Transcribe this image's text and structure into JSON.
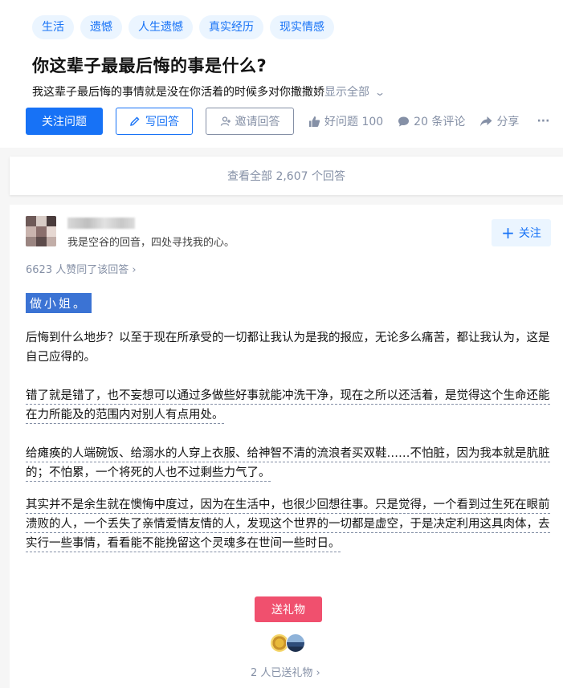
{
  "question": {
    "tags": [
      "生活",
      "遗憾",
      "人生遗憾",
      "真实经历",
      "现实情感"
    ],
    "title": "你这辈子最最后悔的事是什么?",
    "description": "我这辈子最后悔的事情就是没在你活着的时候多对你撒撒娇",
    "show_all": "显示全部",
    "follow_label": "关注问题",
    "write_label": "写回答",
    "invite_label": "邀请回答",
    "good_label": "好问题 100",
    "comments_label": "20 条评论",
    "share_label": "分享",
    "more_label": "···"
  },
  "view_all": "查看全部 2,607 个回答",
  "answer": {
    "bio": "我是空谷的回音，四处寻找我的心。",
    "follow_label": "关注",
    "votes": "6623 人赞同了该回答",
    "highlight": "做小姐。",
    "paragraphs": [
      "后悔到什么地步？以至于现在所承受的一切都让我认为是我的报应，无论多么痛苦，都让我认为，这是自己应得的。",
      "错了就是错了，也不妄想可以通过多做些好事就能冲洗干净，现在之所以还活着，是觉得这个生命还能在力所能及的范围内对别人有点用处。",
      "给瘫痪的人端碗饭、给溺水的人穿上衣服、给神智不清的流浪者买双鞋……不怕脏，因为我本就是肮脏的；不怕累，一个将死的人也不过剩些力气了。",
      "其实并不是余生就在懊悔中度过，因为在生活中，也很少回想往事。只是觉得，一个看到过生死在眼前溃败的人，一个丢失了亲情爱情友情的人，发现这个世界的一切都是虚空，于是决定利用这具肉体，去实行一些事情，看看能不能挽留这个灵魂多在世间一些时日。"
    ],
    "gift_label": "送礼物",
    "gift_count": "2 人已送礼物",
    "colors": {
      "accent": "#1772f6",
      "gift": "#f0506e",
      "highlight": "#3b73d4"
    }
  }
}
